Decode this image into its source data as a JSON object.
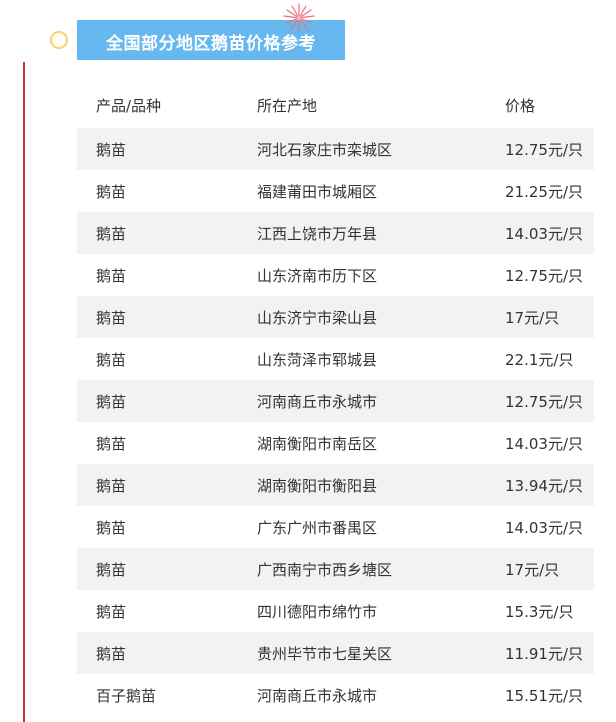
{
  "title": "全国部分地区鹅苗价格参考",
  "colors": {
    "title_bg": "#67b8ee",
    "accent_rule": "#c0392b",
    "ring": "#f3d46b",
    "row_shade": "#f2f2f2"
  },
  "table": {
    "headers": [
      "产品/品种",
      "所在产地",
      "价格"
    ],
    "rows": [
      {
        "product": "鹅苗",
        "origin": "河北石家庄市栾城区",
        "price": "12.75元/只"
      },
      {
        "product": "鹅苗",
        "origin": "福建莆田市城厢区",
        "price": "21.25元/只"
      },
      {
        "product": "鹅苗",
        "origin": "江西上饶市万年县",
        "price": "14.03元/只"
      },
      {
        "product": "鹅苗",
        "origin": "山东济南市历下区",
        "price": "12.75元/只"
      },
      {
        "product": "鹅苗",
        "origin": "山东济宁市梁山县",
        "price": "17元/只"
      },
      {
        "product": "鹅苗",
        "origin": "山东菏泽市郓城县",
        "price": "22.1元/只"
      },
      {
        "product": "鹅苗",
        "origin": "河南商丘市永城市",
        "price": "12.75元/只"
      },
      {
        "product": "鹅苗",
        "origin": "湖南衡阳市南岳区",
        "price": "14.03元/只"
      },
      {
        "product": "鹅苗",
        "origin": "湖南衡阳市衡阳县",
        "price": "13.94元/只"
      },
      {
        "product": "鹅苗",
        "origin": "广东广州市番禺区",
        "price": "14.03元/只"
      },
      {
        "product": "鹅苗",
        "origin": "广西南宁市西乡塘区",
        "price": "17元/只"
      },
      {
        "product": "鹅苗",
        "origin": "四川德阳市绵竹市",
        "price": "15.3元/只"
      },
      {
        "product": "鹅苗",
        "origin": "贵州毕节市七星关区",
        "price": "11.91元/只"
      },
      {
        "product": "百子鹅苗",
        "origin": "河南商丘市永城市",
        "price": "15.51元/只"
      }
    ]
  },
  "icons": {
    "ring": "ring-icon",
    "burst": "burst-icon"
  }
}
